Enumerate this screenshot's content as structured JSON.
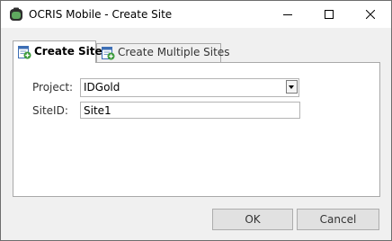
{
  "window": {
    "title": "OCRIS Mobile - Create Site"
  },
  "tabs": [
    {
      "label": "Create Site",
      "active": true
    },
    {
      "label": "Create Multiple Sites",
      "active": false
    }
  ],
  "form": {
    "project_label": "Project:",
    "project_value": "IDGold",
    "siteid_label": "SiteID:",
    "siteid_value": "Site1"
  },
  "buttons": {
    "ok": "OK",
    "cancel": "Cancel"
  },
  "colors": {
    "app_icon": "#5fa85f",
    "tab_icon_badge": "#3a9a3a"
  }
}
